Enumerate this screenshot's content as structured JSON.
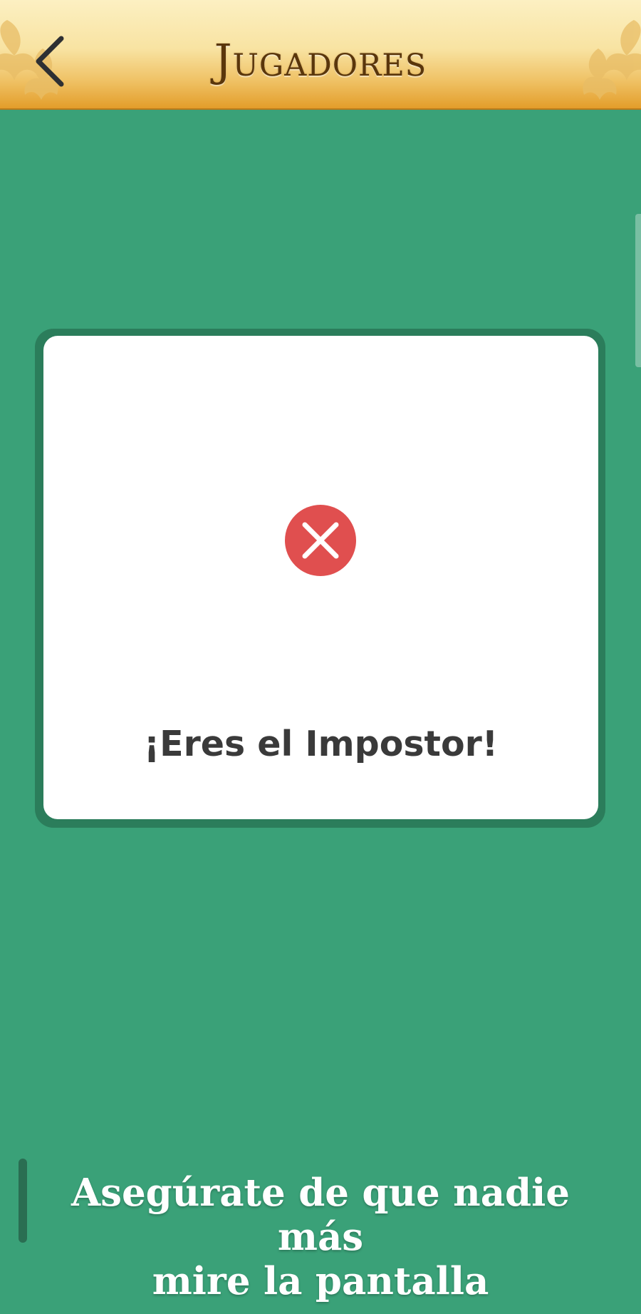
{
  "header": {
    "title": "Jugadores",
    "back_icon": "chevron-left-icon",
    "ornament_icon": "fleur-de-lis-ornament-icon",
    "colors": {
      "gradient_top": "#fcf0c2",
      "gradient_bottom": "#e39d2a",
      "title": "#5a360b"
    }
  },
  "card": {
    "status_icon": "close-circle-icon",
    "status_icon_color": "#e04f4f",
    "message": "¡Eres el Impostor!"
  },
  "footer": {
    "warning_line_1": "Asegúrate de que nadie más",
    "warning_line_2": "mire la pantalla"
  },
  "colors": {
    "background": "#3aa178",
    "card_border": "#2b7d5b",
    "card_background": "#ffffff"
  }
}
